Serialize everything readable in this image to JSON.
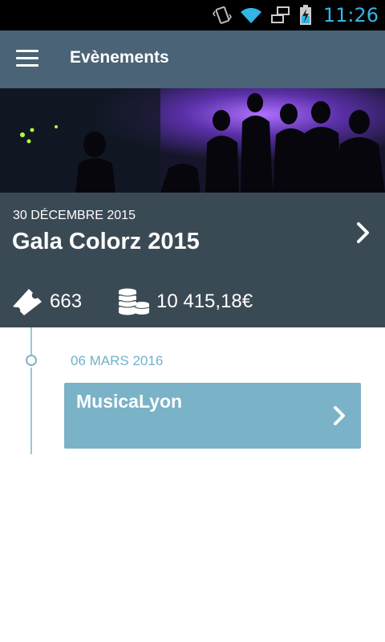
{
  "status_bar": {
    "time": "11:26",
    "icons": [
      "vibrate-icon",
      "wifi-icon",
      "network-icon",
      "battery-charging-icon"
    ]
  },
  "app_bar": {
    "title": "Evènements",
    "menu_icon": "hamburger-menu-icon"
  },
  "featured_event": {
    "date": "30 DÉCEMBRE 2015",
    "name": "Gala Colorz 2015",
    "tickets": "663",
    "revenue": "10 415,18€",
    "ticket_icon": "ticket-icon",
    "revenue_icon": "coins-icon"
  },
  "timeline": {
    "items": [
      {
        "date": "06 MARS 2016",
        "name": "MusicaLyon"
      }
    ]
  },
  "colors": {
    "app_bar": "#4a6376",
    "event_overlay": "#3a4a55",
    "timeline_card": "#7ab2c8",
    "timeline_accent": "#6fb2c9",
    "status_time": "#33b5e5"
  }
}
